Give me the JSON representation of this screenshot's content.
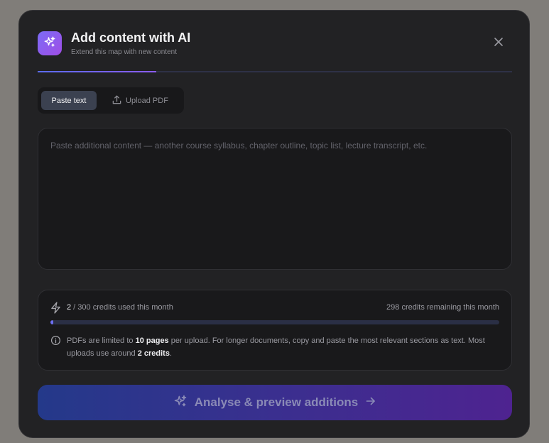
{
  "header": {
    "title": "Add content with AI",
    "subtitle": "Extend this map with new content",
    "badge_icon": "sparkles-icon",
    "close_icon": "close-icon"
  },
  "progress": {
    "step_fraction": 0.25
  },
  "tabs": {
    "paste_label": "Paste text",
    "upload_label": "Upload PDF",
    "active": "paste"
  },
  "input": {
    "value": "",
    "placeholder": "Paste additional content — another course syllabus, chapter outline, topic list, lecture transcript, etc."
  },
  "credits": {
    "used": "2",
    "used_suffix": " / 300 credits used this month",
    "remaining_text": "298 credits remaining this month",
    "used_fraction": 0.0067,
    "note_prefix": "PDFs are limited to ",
    "note_bold1": "10 pages",
    "note_middle": " per upload. For longer documents, copy and paste the most relevant sections as text. Most uploads use around ",
    "note_bold2": "2 credits",
    "note_suffix": "."
  },
  "cta": {
    "label": "Analyse & preview additions",
    "icon": "sparkles-icon",
    "arrow_icon": "arrow-right-icon"
  },
  "colors": {
    "accent": "#7b6cf6",
    "modal_bg": "#222224",
    "cta_start": "#24398a",
    "cta_end": "#4e2390"
  }
}
